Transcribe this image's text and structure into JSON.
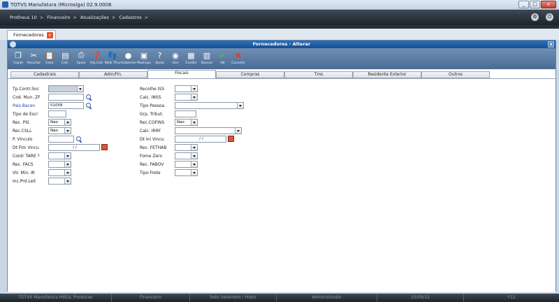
{
  "window": {
    "title": "TOTVS Manufatura (Microsiga) 02.9.0006",
    "controls": [
      "_",
      "□",
      "x"
    ]
  },
  "menubar": {
    "breadcrumbs": [
      "Protheus 10",
      "Financeiro",
      "Atualizações",
      "Cadastros"
    ],
    "separator": ">"
  },
  "document_tab": {
    "label": "Fornecedores"
  },
  "dialog": {
    "title": "Fornecedores - Alterar"
  },
  "toolbar": [
    {
      "label": "Copiar",
      "icon": "copy-icon"
    },
    {
      "label": "Recortar",
      "icon": "scissors-icon"
    },
    {
      "label": "Colar",
      "icon": "paste-icon"
    },
    {
      "label": "Calc.",
      "icon": "calculator-icon"
    },
    {
      "label": "Spool",
      "icon": "printer-icon"
    },
    {
      "label": "Hlp.Cad.",
      "icon": "help-register-icon"
    },
    {
      "label": "Walk Thru",
      "icon": "footsteps-icon"
    },
    {
      "label": "Ambiente",
      "icon": "globe-icon"
    },
    {
      "label": "Mashups",
      "icon": "mashup-icon"
    },
    {
      "label": "Ajuda",
      "icon": "question-icon"
    },
    {
      "label": "Geo",
      "icon": "geo-globe-icon"
    },
    {
      "label": "Credito",
      "icon": "credit-icon"
    },
    {
      "label": "Bancos",
      "icon": "bank-icon"
    },
    {
      "label": "OK",
      "icon": "check-icon"
    },
    {
      "label": "Cancelar",
      "icon": "cancel-x-icon"
    }
  ],
  "folder_tabs": [
    "Cadastrais",
    "Adm/Fin.",
    "Fiscais",
    "Compras",
    "Tms",
    "Residente Exterior",
    "Outros"
  ],
  "active_tab": "Fiscais",
  "left_fields": [
    {
      "label": "Tp.Contr.Soc",
      "value": ""
    },
    {
      "label": "Cod. Mun. ZF",
      "value": ""
    },
    {
      "label": "Pais Bacen",
      "value": "01058"
    },
    {
      "label": "Tipo de Escr",
      "value": ""
    },
    {
      "label": "Rec. PIS",
      "value": "Nao"
    },
    {
      "label": "Rec.CSLL",
      "value": "Nao"
    },
    {
      "label": "P. Vinculo",
      "value": ""
    },
    {
      "label": "Dt Fim Vincu",
      "value": "/ /"
    },
    {
      "label": "Contr TARE ?",
      "value": ""
    },
    {
      "label": "Rec. FACS",
      "value": ""
    },
    {
      "label": "Vlr. Min. IR",
      "value": ""
    },
    {
      "label": "Inc.Prd.Leit",
      "value": ""
    }
  ],
  "right_fields": [
    {
      "label": "Recolhe ISS",
      "value": ""
    },
    {
      "label": "Calc. INSS",
      "value": ""
    },
    {
      "label": "Tipo Pessoa",
      "value": ""
    },
    {
      "label": "Grp. Tribut.",
      "value": ""
    },
    {
      "label": "Rec.COFINS",
      "value": "Nao"
    },
    {
      "label": "Calc. IRRF",
      "value": ""
    },
    {
      "label": "Dt Ini Vincu",
      "value": "/ /"
    },
    {
      "label": "Rec. FETHAB",
      "value": ""
    },
    {
      "label": "Fome Zero",
      "value": ""
    },
    {
      "label": "Rec. FABOV",
      "value": ""
    },
    {
      "label": "Tipo Frete",
      "value": ""
    }
  ],
  "statusbar": [
    "TOTVS Manufatura HISOL Producao",
    "Financeiro",
    "Sete Setembro / Hobir",
    "Administrador",
    "25/09/12",
    "F12"
  ]
}
